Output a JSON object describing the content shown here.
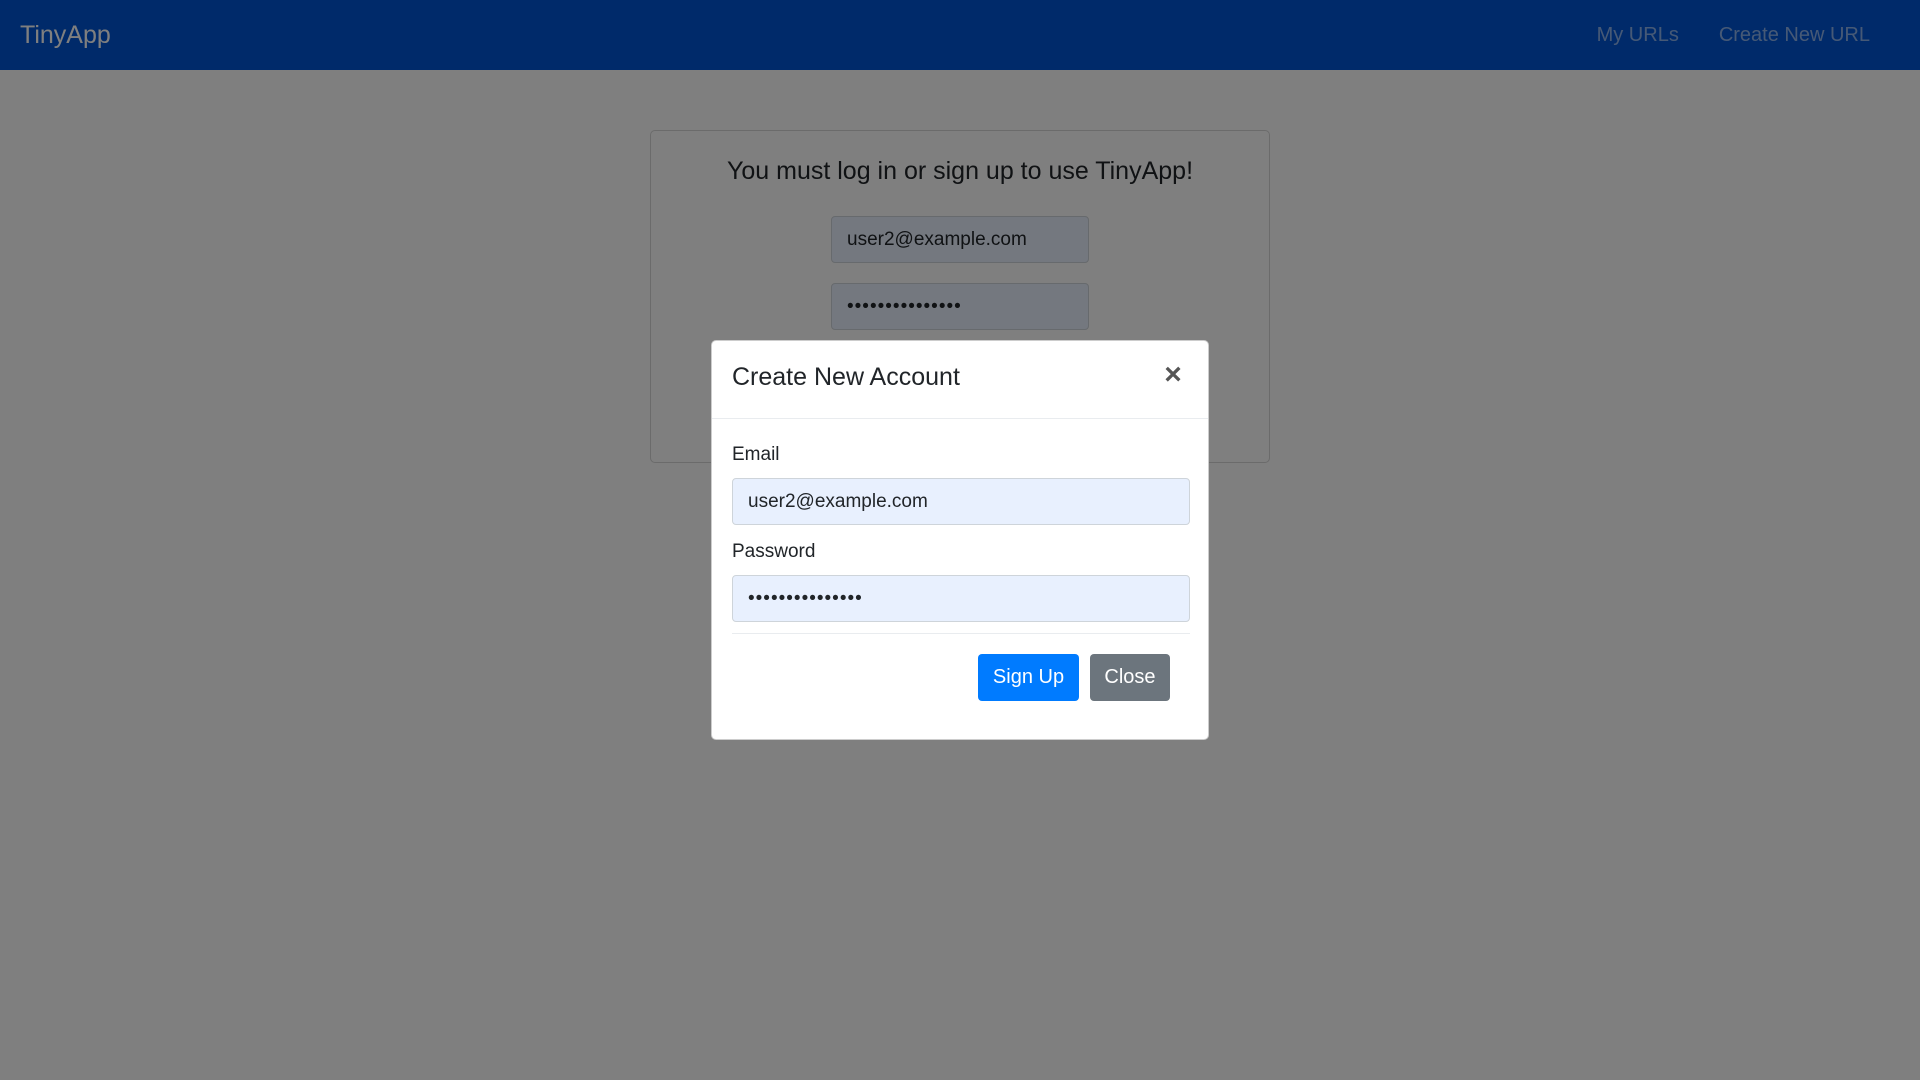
{
  "navbar": {
    "brand": "TinyApp",
    "links": [
      "My URLs",
      "Create New URL"
    ],
    "bg_color": "#0055d4"
  },
  "login": {
    "title": "You must log in or sign up to use TinyApp!",
    "email_value": "user2@example.com",
    "password_value": "•••••••••••••••"
  },
  "modal": {
    "title": "Create New Account",
    "close_symbol": "×",
    "email_label": "Email",
    "email_value": "user2@example.com",
    "password_label": "Password",
    "password_value": "•••••••••••••••",
    "signup_label": "Sign Up",
    "close_label": "Close",
    "signup_color": "#007bff",
    "close_color": "#6c757d"
  }
}
